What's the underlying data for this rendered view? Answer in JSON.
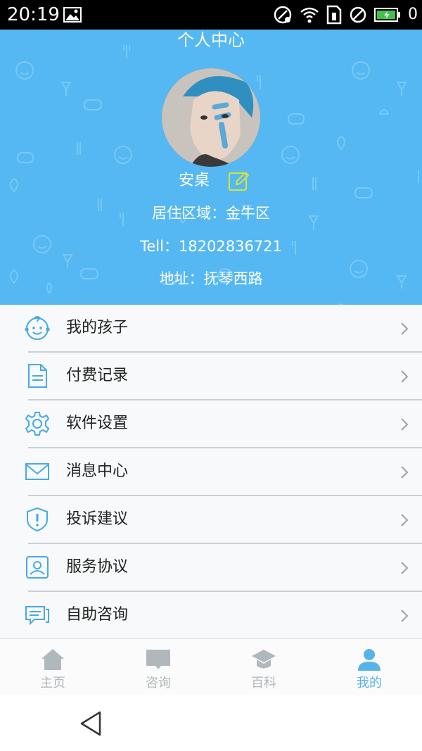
{
  "status_bar": {
    "time": "20:19",
    "battery_level": "0"
  },
  "header": {
    "title": "个人中心",
    "name": "安桌",
    "region": "居住区域：金牛区",
    "tel": "Tell：18202836721",
    "address": "地址：抚琴西路",
    "bg_color": "#55b8f3"
  },
  "menu": {
    "items": [
      {
        "label": "我的孩子",
        "icon": "baby-face-icon"
      },
      {
        "label": "付费记录",
        "icon": "document-icon"
      },
      {
        "label": "软件设置",
        "icon": "gear-icon"
      },
      {
        "label": "消息中心",
        "icon": "envelope-icon"
      },
      {
        "label": "投诉建议",
        "icon": "shield-alert-icon"
      },
      {
        "label": "服务协议",
        "icon": "agent-card-icon"
      },
      {
        "label": "自助咨询",
        "icon": "chat-bubbles-icon"
      }
    ]
  },
  "tabbar": {
    "tabs": [
      {
        "label": "主页",
        "icon": "home-icon",
        "active": false
      },
      {
        "label": "咨询",
        "icon": "chat-icon",
        "active": false
      },
      {
        "label": "百科",
        "icon": "graduation-cap-icon",
        "active": false
      },
      {
        "label": "我的",
        "icon": "person-icon",
        "active": true
      }
    ],
    "active_color": "#57b4e8",
    "inactive_color": "#b0b8bb"
  }
}
